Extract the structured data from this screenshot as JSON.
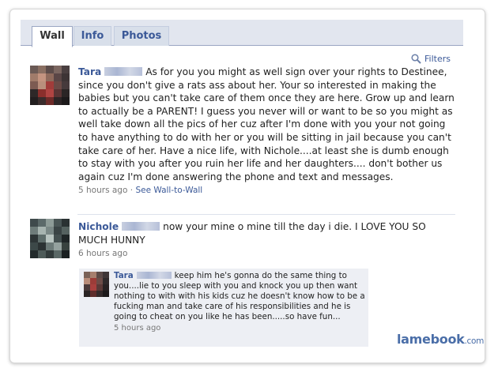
{
  "tabs": [
    {
      "label": "Wall"
    },
    {
      "label": "Info"
    },
    {
      "label": "Photos"
    }
  ],
  "filters_label": "Filters",
  "posts": [
    {
      "author": "Tara",
      "text": "As for you you might as well sign over your rights to Destinee, since you don't give a rats ass about her. Your so interested in making the babies but you can't take care of them once they are here. Grow up and learn to actually be a PARENT! I guess you never will or want to be so you might as well take down all the pics of her cuz after I'm done with you your not going to have anything to do with her or you will be sitting in jail because you can't take care of her. Have a nice life, with Nichole....at least she is dumb enough to stay with you after you ruin her life and her daughters.... don't bother us again cuz I'm done answering the phone and text and messages.",
      "time": "5 hours ago",
      "separator": "·",
      "link": "See Wall-to-Wall"
    },
    {
      "author": "Nichole",
      "text": "now your mine o mine till the day i die. I LOVE YOU SO MUCH HUNNY",
      "time": "6 hours ago"
    }
  ],
  "reply": {
    "author": "Tara",
    "text": "keep him he's gonna do the same thing to you....lie to you sleep with you and knock you up then want nothing to with with his kids cuz he doesn't know how to be a fucking man and take care of his responsibilities and he is going to cheat on you like he has been.....so have fun...",
    "time": "5 hours ago"
  },
  "watermark": {
    "main": "lamebook",
    "suffix": ".com"
  }
}
